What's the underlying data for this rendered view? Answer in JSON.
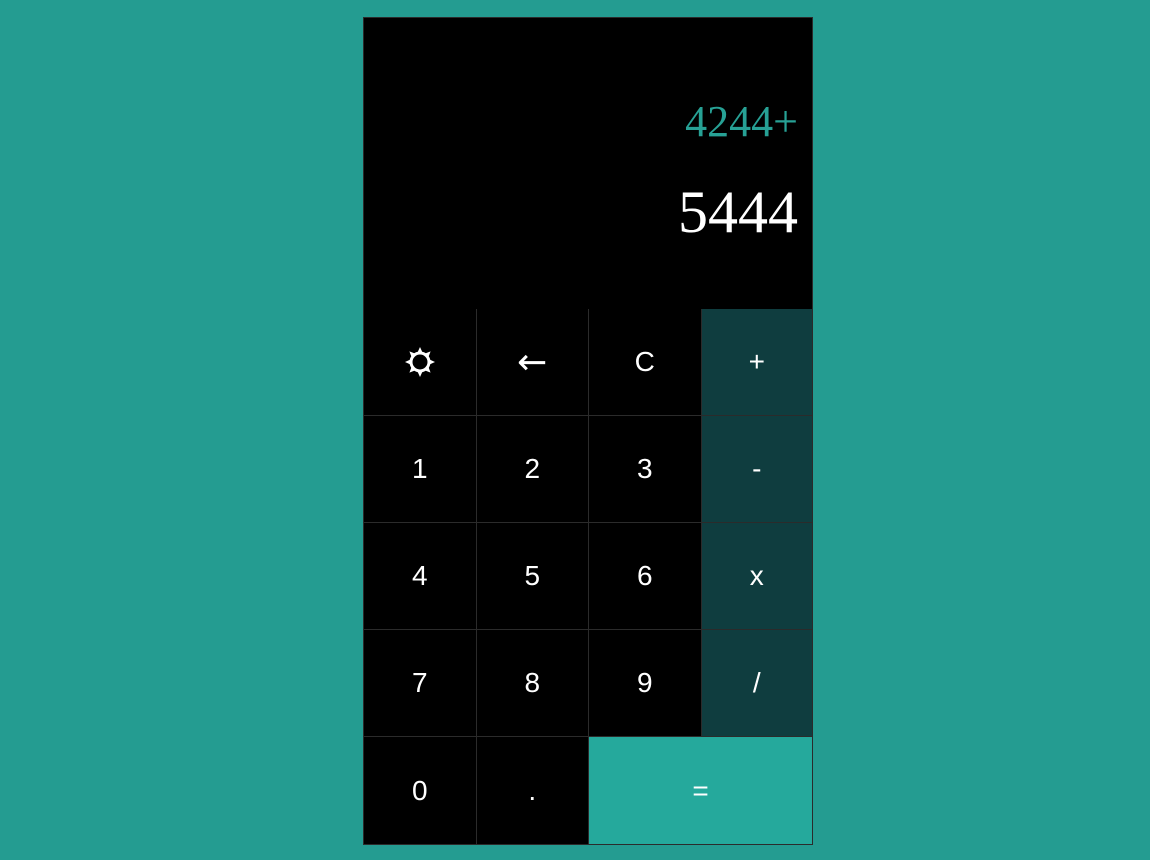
{
  "display": {
    "previous": "4244+",
    "current": "5444"
  },
  "keys": {
    "theme_icon": "sun-icon",
    "backspace": "←",
    "clear": "C",
    "plus": "+",
    "one": "1",
    "two": "2",
    "three": "3",
    "minus": "-",
    "four": "4",
    "five": "5",
    "six": "6",
    "multiply": "x",
    "seven": "7",
    "eight": "8",
    "nine": "9",
    "divide": "/",
    "zero": "0",
    "decimal": ".",
    "equals": "="
  },
  "colors": {
    "page_background": "#249c91",
    "display_background": "#000000",
    "previous_text": "#27a195",
    "operator_key": "#0f3d3f",
    "equals_key": "#25a99c"
  }
}
